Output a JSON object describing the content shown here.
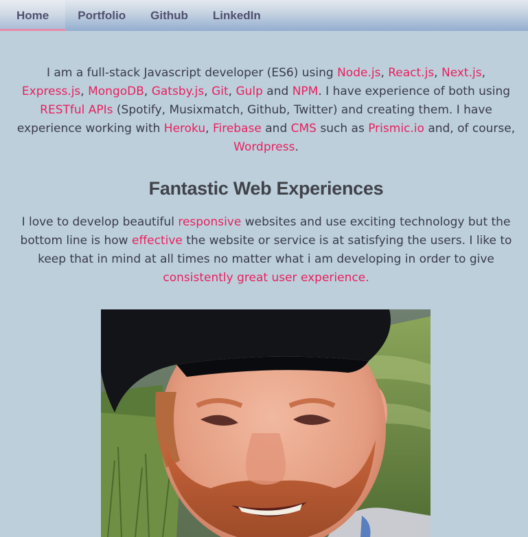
{
  "nav": {
    "items": [
      {
        "label": "Home"
      },
      {
        "label": "Portfolio"
      },
      {
        "label": "Github"
      },
      {
        "label": "LinkedIn"
      }
    ]
  },
  "intro": {
    "t1": "I am a full-stack Javascript developer (ES6) using ",
    "node": "Node.js",
    "c1": ", ",
    "react": "React.js",
    "c2": ", ",
    "next": "Next.js",
    "c3": ", ",
    "express": "Express.js",
    "c4": ", ",
    "mongo": "MongoDB",
    "c5": ", ",
    "gatsby": "Gatsby.js",
    "c6": ", ",
    "git": "Git",
    "c7": ", ",
    "gulp": "Gulp",
    "and1": " and ",
    "npm": "NPM",
    "t2": ". I have experience of both using ",
    "rest": "RESTful APIs",
    "t3": " (Spotify, Musixmatch, Github, Twitter) and creating them. I have experience working with ",
    "heroku": "Heroku",
    "c8": ", ",
    "firebase": "Firebase",
    "and2": " and ",
    "cms": "CMS",
    "t4": " such as ",
    "prismic": "Prismic.io",
    "t5": " and, of course, ",
    "wordpress": "Wordpress",
    "t6": "."
  },
  "section": {
    "title": "Fantastic Web Experiences",
    "t1": "I love to develop beautiful ",
    "responsive": "responsive",
    "t2": " websites and use exciting technology but the bottom line is how ",
    "effective": "effective",
    "t3": " the website or service is at satisfying the users. I like to keep that in mind at all times no matter what i am developing in order to give ",
    "consistent": "consistently great user experience."
  },
  "colors": {
    "accent": "#ea1f5e",
    "background": "#bccfdb",
    "nav_text": "#4f4f6e",
    "active_underline": "#e88aa8"
  },
  "photo": {
    "icon": "profile-photo"
  }
}
